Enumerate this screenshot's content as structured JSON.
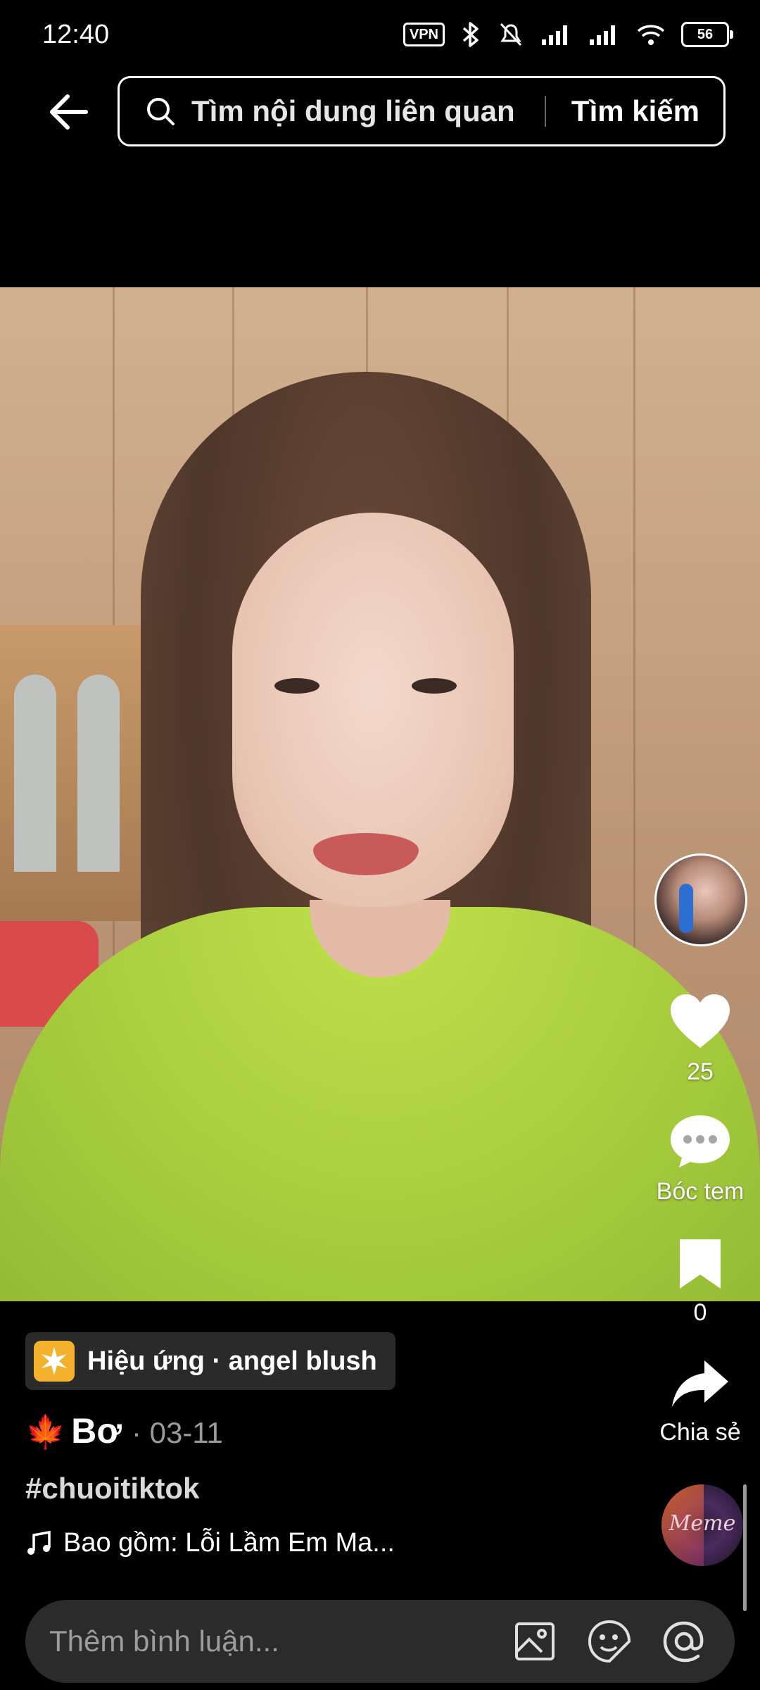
{
  "status_bar": {
    "time": "12:40",
    "vpn_label": "VPN",
    "battery_level": "56",
    "icons": [
      "vpn-icon",
      "bluetooth-icon",
      "silent-icon",
      "signal-icon",
      "signal-icon",
      "wifi-icon",
      "battery-icon"
    ]
  },
  "header": {
    "search_placeholder": "Tìm nội dung liên quan",
    "search_button": "Tìm kiếm"
  },
  "rail": {
    "like_count": "25",
    "comment_label": "Bóc tem",
    "bookmark_count": "0",
    "share_label": "Chia sẻ",
    "disc_logo": "Meme"
  },
  "info": {
    "effect_label": "Hiệu ứng · angel blush",
    "author_emoji": "🍁",
    "author_name": "Bơ",
    "post_date": "· 03-11",
    "hashtag": "#chuoitiktok",
    "music": "Bao gồm: Lỗi Lầm Em Ma..."
  },
  "comment_bar": {
    "placeholder": "Thêm bình luận..."
  },
  "colors": {
    "background": "#000000",
    "chip_bg": "#2a2a2a",
    "effect_icon_bg": "#f4b12d",
    "muted_text": "#9a9a9a"
  }
}
